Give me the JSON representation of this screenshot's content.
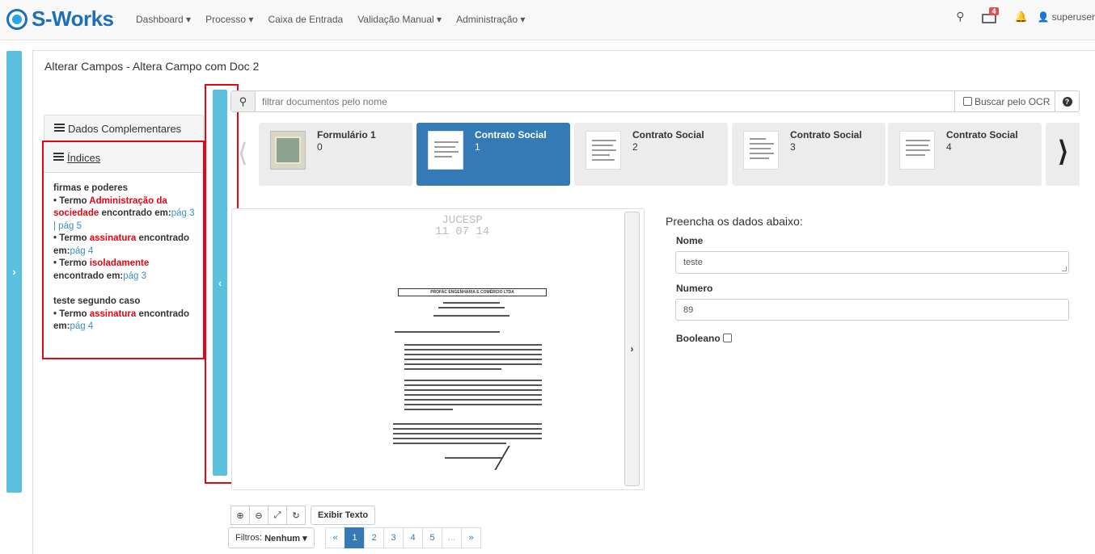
{
  "navbar": {
    "brand": "S-Works",
    "menu": [
      "Dashboard ▾",
      "Processo ▾",
      "Caixa de Entrada",
      "Validação Manual ▾",
      "Administração ▾"
    ],
    "inbox_badge": "4",
    "user": "superuser"
  },
  "panel": {
    "title": "Alterar Campos - Altera Campo com Doc 2"
  },
  "sidebar": {
    "dados_label": "Dados Complementares",
    "indices_label": "Índices",
    "groups": [
      {
        "title": "firmas e poderes",
        "terms": [
          {
            "prefix": "• Termo ",
            "term": "Administração da sociedade",
            "suffix": " encontrado em:",
            "links": "pág 3 | pág 5"
          },
          {
            "prefix": "• Termo ",
            "term": "assinatura",
            "suffix": " encontrado em:",
            "links": "pág 4"
          },
          {
            "prefix": "• Termo ",
            "term": "isoladamente",
            "suffix": " encontrado em:",
            "links": "pág 3"
          }
        ]
      },
      {
        "title": "teste segundo caso",
        "terms": [
          {
            "prefix": "• Termo ",
            "term": "assinatura",
            "suffix": " encontrado em:",
            "links": "pág 4"
          }
        ]
      }
    ]
  },
  "search": {
    "placeholder": "filtrar documentos pelo nome",
    "ocr_label": "Buscar pelo OCR"
  },
  "documents": [
    {
      "name": "Formulário 1",
      "num": "0"
    },
    {
      "name": "Contrato Social",
      "num": "1"
    },
    {
      "name": "Contrato Social",
      "num": "2"
    },
    {
      "name": "Contrato Social",
      "num": "3"
    },
    {
      "name": "Contrato Social",
      "num": "4"
    }
  ],
  "viewer": {
    "stamp_line1": "JUCESP",
    "stamp_line2": "11 07 14",
    "header_text": "PROFAC ENGENHARIA E COMÉRCIO LTDA"
  },
  "form": {
    "title": "Preencha os dados abaixo:",
    "nome_label": "Nome",
    "nome_value": "teste",
    "numero_label": "Numero",
    "numero_value": "89",
    "booleano_label": "Booleano"
  },
  "toolbar": {
    "exibir_texto": "Exibir Texto",
    "filtros_label": "Filtros:",
    "filtros_value": "Nenhum ▾"
  },
  "pagination": [
    "«",
    "1",
    "2",
    "3",
    "4",
    "5",
    "...",
    "»"
  ]
}
